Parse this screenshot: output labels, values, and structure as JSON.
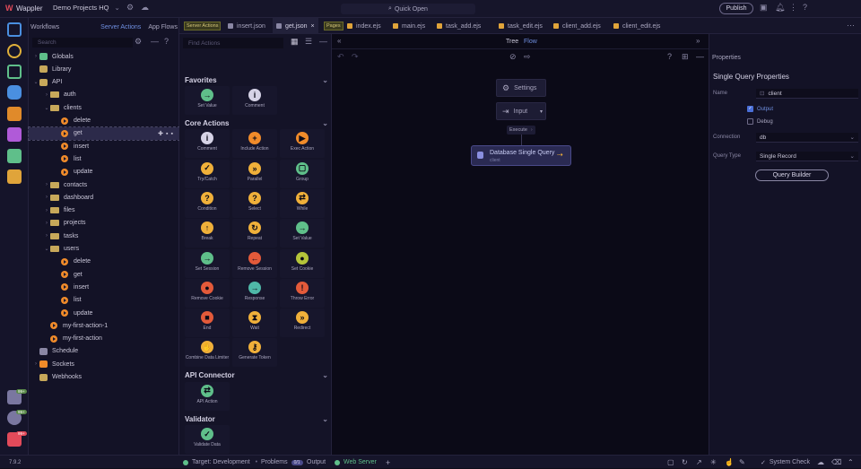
{
  "titlebar": {
    "app_name": "Wappler",
    "project": "Demo Projects HQ",
    "quick_open": "Quick Open",
    "publish": "Publish"
  },
  "panel1": {
    "tabs": [
      "Workflows",
      "Server Actions",
      "App Flows"
    ],
    "search_placeholder": "Search",
    "tree": [
      {
        "label": "Globals",
        "level": 0,
        "kind": "globe"
      },
      {
        "label": "Library",
        "level": 0,
        "kind": "lib"
      },
      {
        "label": "API",
        "level": 0,
        "kind": "api"
      },
      {
        "label": "auth",
        "level": 1,
        "kind": "folder"
      },
      {
        "label": "clients",
        "level": 1,
        "kind": "folder-open"
      },
      {
        "label": "delete",
        "level": 2,
        "kind": "action"
      },
      {
        "label": "get",
        "level": 2,
        "kind": "action",
        "selected": true
      },
      {
        "label": "insert",
        "level": 2,
        "kind": "action"
      },
      {
        "label": "list",
        "level": 2,
        "kind": "action"
      },
      {
        "label": "update",
        "level": 2,
        "kind": "action"
      },
      {
        "label": "contacts",
        "level": 1,
        "kind": "folder"
      },
      {
        "label": "dashboard",
        "level": 1,
        "kind": "folder"
      },
      {
        "label": "files",
        "level": 1,
        "kind": "folder"
      },
      {
        "label": "projects",
        "level": 1,
        "kind": "folder"
      },
      {
        "label": "tasks",
        "level": 1,
        "kind": "folder"
      },
      {
        "label": "users",
        "level": 1,
        "kind": "folder-open"
      },
      {
        "label": "delete",
        "level": 2,
        "kind": "action"
      },
      {
        "label": "get",
        "level": 2,
        "kind": "action"
      },
      {
        "label": "insert",
        "level": 2,
        "kind": "action"
      },
      {
        "label": "list",
        "level": 2,
        "kind": "action"
      },
      {
        "label": "update",
        "level": 2,
        "kind": "action"
      },
      {
        "label": "my-first-action-1",
        "level": 1,
        "kind": "action"
      },
      {
        "label": "my-first-action",
        "level": 1,
        "kind": "action"
      },
      {
        "label": "Schedule",
        "level": 0,
        "kind": "sched"
      },
      {
        "label": "Sockets",
        "level": 0,
        "kind": "sockets"
      },
      {
        "label": "Webhooks",
        "level": 0,
        "kind": "hooks"
      }
    ]
  },
  "tabs": {
    "server_actions_badge": "Server Actions",
    "pages_badge": "Pages",
    "items": [
      "insert.json",
      "get.json",
      "index.ejs",
      "main.ejs",
      "task_add.ejs",
      "task_edit.ejs",
      "client_add.ejs",
      "client_edit.ejs"
    ]
  },
  "toolbar": {
    "find_placeholder": "Find Actions",
    "tree": "Tree",
    "flow": "Flow"
  },
  "actions": {
    "favorites_title": "Favorites",
    "favorites": [
      {
        "label": "Set Value",
        "color": "#5fbf8a",
        "glyph": "→"
      },
      {
        "label": "Comment",
        "color": "#d6d3e6",
        "glyph": "i"
      }
    ],
    "core_title": "Core Actions",
    "core": [
      {
        "label": "Comment",
        "color": "#d6d3e6",
        "glyph": "i"
      },
      {
        "label": "Include Action",
        "color": "#f08b2a",
        "glyph": "+"
      },
      {
        "label": "Exec Action",
        "color": "#f08b2a",
        "glyph": "▶"
      },
      {
        "label": "Try/Catch",
        "color": "#f0b03a",
        "glyph": "✓"
      },
      {
        "label": "Parallel",
        "color": "#f0b03a",
        "glyph": "»"
      },
      {
        "label": "Group",
        "color": "#5fbf8a",
        "glyph": "▢"
      },
      {
        "label": "Condition",
        "color": "#f0b03a",
        "glyph": "?"
      },
      {
        "label": "Select",
        "color": "#f0b03a",
        "glyph": "?"
      },
      {
        "label": "While",
        "color": "#f0b03a",
        "glyph": "⇄"
      },
      {
        "label": "Break",
        "color": "#f0b03a",
        "glyph": "↑"
      },
      {
        "label": "Repeat",
        "color": "#f0b03a",
        "glyph": "↻"
      },
      {
        "label": "Set Value",
        "color": "#5fbf8a",
        "glyph": "→"
      },
      {
        "label": "Set Session",
        "color": "#5fbf8a",
        "glyph": "→"
      },
      {
        "label": "Remove Session",
        "color": "#e35a3a",
        "glyph": "←"
      },
      {
        "label": "Set Cookie",
        "color": "#b5c43a",
        "glyph": "●"
      },
      {
        "label": "Remove Cookie",
        "color": "#e35a3a",
        "glyph": "●"
      },
      {
        "label": "Response",
        "color": "#4fb8a8",
        "glyph": "→"
      },
      {
        "label": "Throw Error",
        "color": "#e35a3a",
        "glyph": "!"
      },
      {
        "label": "End",
        "color": "#e35a3a",
        "glyph": "■"
      },
      {
        "label": "Wait",
        "color": "#f0b03a",
        "glyph": "⧗"
      },
      {
        "label": "Redirect",
        "color": "#f0b03a",
        "glyph": "»"
      },
      {
        "label": "Combine Data Limiter",
        "color": "#f0b03a",
        "glyph": "✋"
      },
      {
        "label": "Generate Token",
        "color": "#f0b03a",
        "glyph": "⚷"
      }
    ],
    "api_title": "API Connector",
    "api": [
      {
        "label": "API Action",
        "color": "#5fbf8a",
        "glyph": "⇄"
      }
    ],
    "validator_title": "Validator",
    "validator": [
      {
        "label": "Validate Data",
        "color": "#5fbf8a",
        "glyph": "✓"
      }
    ]
  },
  "canvas": {
    "settings": "Settings",
    "input": "Input",
    "execute": "Execute",
    "node_title": "Database Single Query",
    "node_sub": "client"
  },
  "properties": {
    "header": "Properties",
    "title": "Single Query Properties",
    "name_label": "Name",
    "name_value": "client",
    "output_label": "Output",
    "debug_label": "Debug",
    "connection_label": "Connection",
    "connection_value": "db",
    "query_type_label": "Query Type",
    "query_type_value": "Single Record",
    "query_builder": "Query Builder"
  },
  "statusbar": {
    "version": "7.9.2",
    "target": "Target: Development",
    "problems": "Problems",
    "problems_count": "0/1",
    "output": "Output",
    "web_server": "Web Server",
    "system_check": "System Check"
  },
  "leftbar": {
    "badge1": "99+",
    "badge2": "99+",
    "badge3": "99+"
  },
  "colors": {
    "accent": "#4a6fd8",
    "action_orange": "#f08b2a",
    "folder": "#c7a85a",
    "selected_row": "#2c2a4a"
  }
}
